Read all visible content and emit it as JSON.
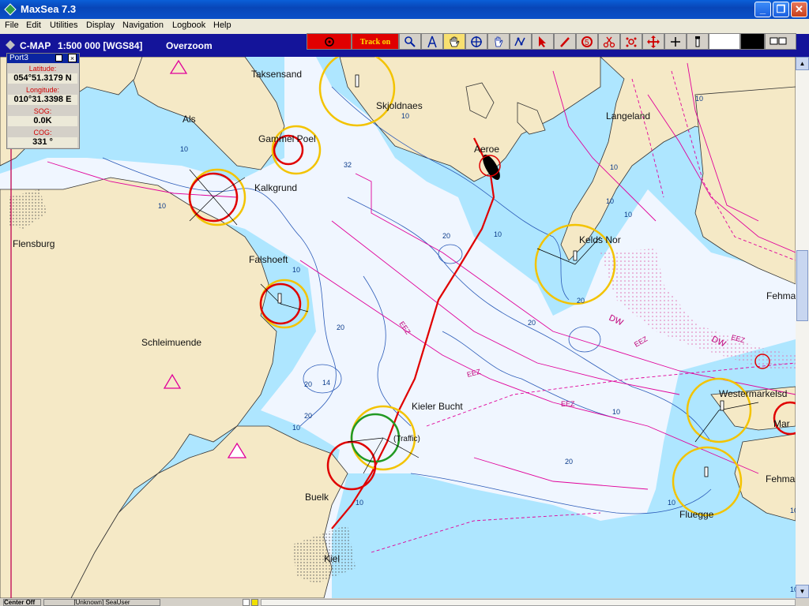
{
  "window": {
    "title": "MaxSea 7.3"
  },
  "menu": [
    "File",
    "Edit",
    "Utilities",
    "Display",
    "Navigation",
    "Logbook",
    "Help"
  ],
  "chart_header": {
    "source": "C-MAP",
    "scale": "1:500 000 [WGS84]",
    "mode": "Overzoom"
  },
  "toolbar": {
    "track_label": "Track on",
    "tools": [
      "zoom-icon",
      "compass-icon",
      "hand-pan-icon",
      "crosshair-icon",
      "hand-select-icon",
      "route-icon",
      "pointer-icon",
      "pencil-icon",
      "undo-icon",
      "scissors-icon",
      "group-icon",
      "move-icon",
      "plus-icon",
      "lighthouse-icon"
    ]
  },
  "info_panel": {
    "title": "Port3",
    "rows": [
      {
        "label": "Latitude:",
        "value": "054°51.3179 N"
      },
      {
        "label": "Longitude:",
        "value": "010°31.3398 E"
      },
      {
        "label": "SOG:",
        "value": "0.0K"
      },
      {
        "label": "COG:",
        "value": "331 °"
      }
    ]
  },
  "map_labels": {
    "taksensand": "Taksensand",
    "als": "Als",
    "gammel_poel": "Gammel Poel",
    "kalkgrund": "Kalkgrund",
    "flensburg": "Flensburg",
    "skjoldnaes": "Skjoldnaes",
    "aeroe": "Aeroe",
    "langeland": "Langeland",
    "keldsnor": "Kelds Nor",
    "falshoeft": "Falshoeft",
    "schleimuende": "Schleimuende",
    "kieler_bucht": "Kieler Bucht",
    "traffic": "(Traffic)",
    "buelk": "Buelk",
    "kiel": "Kiel",
    "fehmarn1": "Fehma",
    "westermarkelsd": "Westermarkelsd",
    "mar": "Mar",
    "fehmarn2": "Fehma",
    "fluegge": "Fluegge",
    "eez1": "EEZ",
    "eez2": "EEZ",
    "eez3": "EEZ",
    "eez4": "EEZ",
    "eez5": "EEZ",
    "dw1": "DW",
    "dw2": "DW"
  },
  "depth_labels": [
    "32",
    "20",
    "20",
    "20",
    "14",
    "20",
    "20",
    "20",
    "20",
    "10",
    "10",
    "10",
    "10",
    "10",
    "10",
    "10",
    "10",
    "10",
    "10",
    "10",
    "10",
    "10",
    "10",
    "10"
  ],
  "status": {
    "center_label": "Center Off",
    "user": "[Unknown] SeaUser"
  },
  "colors": {
    "water_deep": "#f0f6ff",
    "water_shallow": "#aee6ff",
    "land": "#f5e9c6",
    "track": "#e00000",
    "shipping_lanes": "#e0009a",
    "sector_yellow": "#f3c300"
  }
}
